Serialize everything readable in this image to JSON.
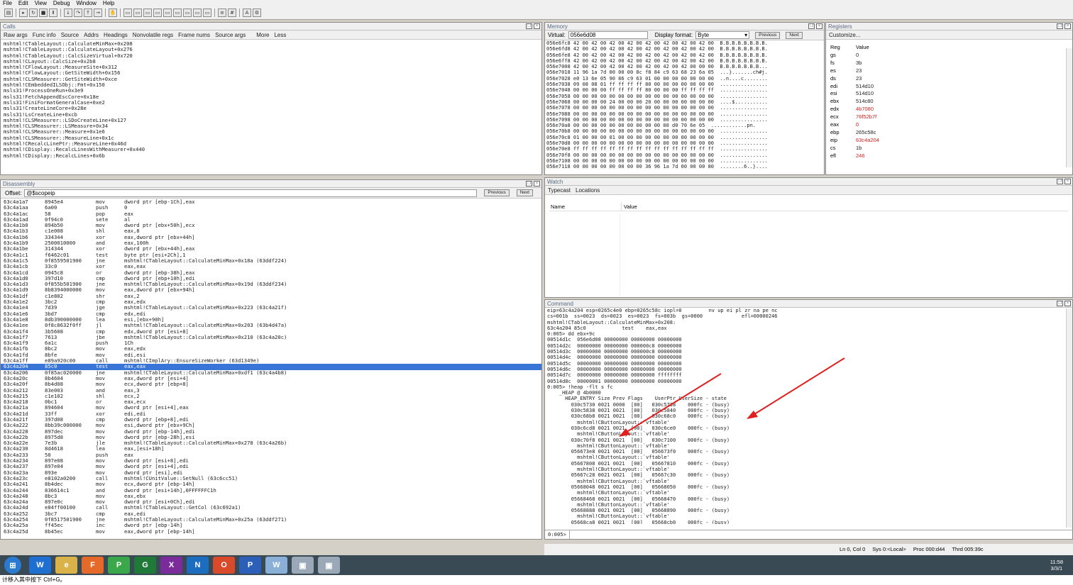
{
  "menu": [
    "File",
    "Edit",
    "View",
    "Debug",
    "Window",
    "Help"
  ],
  "calls": {
    "title": "Calls",
    "tabs": [
      "Raw args",
      "Func info",
      "Source",
      "Addrs",
      "Headings",
      "Nonvolatile regs",
      "Frame nums",
      "Source args",
      "More",
      "Less"
    ],
    "lines": [
      "mshtml!CTableLayout::CalculateMinMax+0x208",
      "mshtml!CTableLayout::CalculateLayout+0x276",
      "mshtml!CTableLayout::CalcSizeVirtual+0x720",
      "mshtml!CLayout::CalcSize+0x2b8",
      "mshtml!CFlowLayout::MeasureSite+0x312",
      "mshtml!CFlowLayout::GetSiteWidth+0x156",
      "mshtml!CLSMeasurer::GetSiteWidth+0xce",
      "mshtml!CEmbeddedILSObj::Fmt+0x150",
      "msls31!ProcessOneRun+0x3e9",
      "msls31!FetchAppendEscCore+0x18e",
      "msls31!FiniFormatGeneralCase+0xe2",
      "msls31!CreateLineCore+0x28e",
      "msls31!LsCreateLine+0xcb",
      "mshtml!CLSMeasurer::LSDoCreateLine+0x127",
      "mshtml!CLSMeasurer::LSMeasure+0x34",
      "mshtml!CLSMeasurer::Measure+0x1e6",
      "mshtml!CLSMeasurer::MeasureLine+0x1c",
      "mshtml!CRecalcLinePtr::MeasureLine+0x46d",
      "mshtml!CDisplay::RecalcLinesWithMeasurer+0x440",
      "mshtml!CDisplay::RecalcLines+0x6b"
    ]
  },
  "memory": {
    "title": "Memory",
    "virtual_label": "Virtual:",
    "virtual_value": "056e6d08",
    "format_label": "Display format:",
    "format_value": "Byte",
    "prev": "Previous",
    "next": "Next",
    "lines": [
      "056e6fc8 42 00 42 00 42 00 42 00 42 00 42 00 42 00 42 00  B.B.B.B.B.B.B.B.",
      "056e6fd8 42 00 42 00 42 00 42 00 42 00 42 00 42 00 42 00  B.B.B.B.B.B.B.B.",
      "056e6fe8 42 00 42 00 42 00 42 00 42 00 42 00 42 00 42 00  B.B.B.B.B.B.B.B.",
      "056e6ff8 42 00 42 00 42 00 42 00 42 00 42 00 42 00 42 00  B.B.B.B.B.B.B.B.",
      "056e7008 42 00 42 00 42 00 42 00 42 00 42 00 42 00 00 00  B.B.B.B.B.B.B...",
      "056e7018 11 96 1a 7d 00 00 00 8c f8 84 c9 63 68 23 6a 05  ...}.......ch#j.",
      "056e7028 e0 13 6e 05 90 86 c9 63 01 00 00 00 00 00 00 00  ..n....c........",
      "056e7038 09 08 08 01 ff ff ff ff 80 00 00 00 00 00 00 00  ................",
      "056e7048 00 00 00 00 ff ff ff ff 80 00 00 00 ff ff ff ff  ................",
      "056e7058 00 00 00 00 00 00 00 00 00 00 00 00 00 00 00 00  ................",
      "056e7068 00 00 00 00 24 00 00 00 20 00 00 00 00 00 00 00  ....$...........",
      "056e7078 00 00 00 00 00 00 00 00 00 00 00 00 00 00 00 00  ................",
      "056e7088 00 00 00 00 00 00 00 00 00 00 00 00 00 00 00 00  ................",
      "056e7098 00 00 00 00 00 00 00 00 00 00 00 00 00 00 00 00  ................",
      "056e70a8 00 00 00 00 00 00 00 00 00 00 00 d0 70 6e 05  ............pn.",
      "056e70b8 00 00 00 00 00 00 00 00 00 00 00 00 00 00 00 00  ................",
      "056e70c8 01 00 00 00 01 00 00 00 00 00 00 00 00 00 00 00  ................",
      "056e70d8 00 00 00 00 00 00 00 00 00 00 00 00 00 00 00 00  ................",
      "056e70e8 ff ff ff ff ff ff ff ff ff ff ff ff ff ff ff ff  ................",
      "056e70f8 00 00 00 00 00 00 00 00 00 00 00 00 00 00 00 00  ................",
      "056e7108 00 00 00 00 00 00 00 00 00 00 00 00 00 00 00 00  ................",
      "056e7118 00 00 00 00 00 00 00 00 36 96 1a 7d 00 00 00 80  ........6..}...."
    ]
  },
  "registers": {
    "title": "Registers",
    "customize": "Customize...",
    "col_reg": "Reg",
    "col_value": "Value",
    "rows": [
      {
        "r": "gs",
        "v": "0",
        "c": "#222"
      },
      {
        "r": "fs",
        "v": "3b",
        "c": "#222"
      },
      {
        "r": "es",
        "v": "23",
        "c": "#222"
      },
      {
        "r": "ds",
        "v": "23",
        "c": "#222"
      },
      {
        "r": "edi",
        "v": "514d10",
        "c": "#222"
      },
      {
        "r": "esi",
        "v": "514d10",
        "c": "#222"
      },
      {
        "r": "ebx",
        "v": "514c80",
        "c": "#222"
      },
      {
        "r": "edx",
        "v": "4b7080",
        "c": "#d02020"
      },
      {
        "r": "ecx",
        "v": "76f52b7f",
        "c": "#d02020"
      },
      {
        "r": "eax",
        "v": "0",
        "c": "#d02020"
      },
      {
        "r": "ebp",
        "v": "265c58c",
        "c": "#222"
      },
      {
        "r": "eip",
        "v": "63c4a204",
        "c": "#d02020"
      },
      {
        "r": "cs",
        "v": "1b",
        "c": "#222"
      },
      {
        "r": "efl",
        "v": "246",
        "c": "#d02020"
      }
    ]
  },
  "disasm": {
    "title": "Disassembly",
    "offset_label": "Offset:",
    "offset_value": "@$scopeip",
    "prev": "Previous",
    "next": "Next",
    "highlight_index": 28,
    "rows": [
      [
        "63c4a1a7",
        "8945e4",
        "mov",
        "dword ptr [ebp-1Ch],eax"
      ],
      [
        "63c4a1aa",
        "6a00",
        "push",
        "0"
      ],
      [
        "63c4a1ac",
        "58",
        "pop",
        "eax"
      ],
      [
        "63c4a1ad",
        "0f94c0",
        "sete",
        "al"
      ],
      [
        "63c4a1b0",
        "894b50",
        "mov",
        "dword ptr [ebx+50h],ecx"
      ],
      [
        "63c4a1b3",
        "c1e008",
        "shl",
        "eax,8"
      ],
      [
        "63c4a1b6",
        "334344",
        "xor",
        "eax,dword ptr [ebx+44h]"
      ],
      [
        "63c4a1b9",
        "2500010000",
        "and",
        "eax,100h"
      ],
      [
        "63c4a1be",
        "314344",
        "xor",
        "dword ptr [ebx+44h],eax"
      ],
      [
        "63c4a1c1",
        "f6462c01",
        "test",
        "byte ptr [esi+2Ch],1"
      ],
      [
        "63c4a1c5",
        "0f8559501900",
        "jne",
        "mshtml!CTableLayout::CalculateMinMax+0x18a (63ddf224)"
      ],
      [
        "63c4a1cb",
        "33c0",
        "xor",
        "eax,eax"
      ],
      [
        "63c4a1cd",
        "0945c8",
        "or",
        "dword ptr [ebp-38h],eax"
      ],
      [
        "63c4a1d0",
        "397d10",
        "cmp",
        "dword ptr [ebp+10h],edi"
      ],
      [
        "63c4a1d3",
        "0f855b501900",
        "jne",
        "mshtml!CTableLayout::CalculateMinMax+0x19d (63ddf234)"
      ],
      [
        "63c4a1d9",
        "8b8394000000",
        "mov",
        "eax,dword ptr [ebx+94h]"
      ],
      [
        "63c4a1df",
        "c1e802",
        "shr",
        "eax,2"
      ],
      [
        "63c4a1e2",
        "3bc2",
        "cmp",
        "eax,edx"
      ],
      [
        "63c4a1e4",
        "7d39",
        "jge",
        "mshtml!CTableLayout::CalculateMinMax+0x223 (63c4a21f)"
      ],
      [
        "63c4a1e6",
        "3bd7",
        "cmp",
        "edx,edi"
      ],
      [
        "63c4a1e8",
        "8db390000000",
        "lea",
        "esi,[ebx+90h]"
      ],
      [
        "63c4a1ee",
        "0f8c8632f0ff",
        "jl",
        "mshtml!CTableLayout::CalculateMinMax+0x203 (63b4d47a)"
      ],
      [
        "63c4a1f4",
        "3b5608",
        "cmp",
        "edx,dword ptr [esi+8]"
      ],
      [
        "63c4a1f7",
        "7613",
        "jbe",
        "mshtml!CTableLayout::CalculateMinMax+0x210 (63c4a20c)"
      ],
      [
        "63c4a1f9",
        "6a1c",
        "push",
        "1Ch"
      ],
      [
        "63c4a1fb",
        "8bc2",
        "mov",
        "eax,edx"
      ],
      [
        "63c4a1fd",
        "8bfe",
        "mov",
        "edi,esi"
      ],
      [
        "63c4a1ff",
        "e89a920c00",
        "call",
        "mshtml!CImplAry::EnsureSizeWorker (63d1349e)"
      ],
      [
        "63c4a204",
        "85c0",
        "test",
        "eax,eax"
      ],
      [
        "63c4a206",
        "0f85ac020000",
        "jne",
        "mshtml!CTableLayout::CalculateMinMax+0xdf1 (63c4a4b8)"
      ],
      [
        "63c4a20c",
        "8b4604",
        "mov",
        "eax,dword ptr [esi+4]"
      ],
      [
        "63c4a20f",
        "8b4d08",
        "mov",
        "ecx,dword ptr [ebp+8]"
      ],
      [
        "63c4a212",
        "83e003",
        "and",
        "eax,3"
      ],
      [
        "63c4a215",
        "c1e102",
        "shl",
        "ecx,2"
      ],
      [
        "63c4a218",
        "0bc1",
        "or",
        "eax,ecx"
      ],
      [
        "63c4a21a",
        "894604",
        "mov",
        "dword ptr [esi+4],eax"
      ],
      [
        "63c4a21d",
        "33ff",
        "xor",
        "edi,edi"
      ],
      [
        "63c4a21f",
        "397d08",
        "cmp",
        "dword ptr [ebp+8],edi"
      ],
      [
        "63c4a222",
        "8bb39c000000",
        "mov",
        "esi,dword ptr [ebx+9Ch]"
      ],
      [
        "63c4a228",
        "897dec",
        "mov",
        "dword ptr [ebp-14h],edi"
      ],
      [
        "63c4a22b",
        "8975d8",
        "mov",
        "dword ptr [ebp-28h],esi"
      ],
      [
        "63c4a22e",
        "7e3b",
        "jle",
        "mshtml!CTableLayout::CalculateMinMax+0x278 (63c4a26b)"
      ],
      [
        "63c4a230",
        "8d4618",
        "lea",
        "eax,[esi+18h]"
      ],
      [
        "63c4a233",
        "50",
        "push",
        "eax"
      ],
      [
        "63c4a234",
        "897e08",
        "mov",
        "dword ptr [esi+8],edi"
      ],
      [
        "63c4a237",
        "897e04",
        "mov",
        "dword ptr [esi+4],edi"
      ],
      [
        "63c4a23a",
        "893e",
        "mov",
        "dword ptr [esi],edi"
      ],
      [
        "63c4a23c",
        "e8102a0200",
        "call",
        "mshtml!CUnitValue::SetNull (63c6cc51)"
      ],
      [
        "63c4a241",
        "8b4dec",
        "mov",
        "ecx,dword ptr [ebp-14h]"
      ],
      [
        "63c4a244",
        "836614c1",
        "and",
        "dword ptr [esi+14h],0FFFFFFC1h"
      ],
      [
        "63c4a248",
        "8bc3",
        "mov",
        "eax,ebx"
      ],
      [
        "63c4a24a",
        "897e0c",
        "mov",
        "dword ptr [esi+0Ch],edi"
      ],
      [
        "63c4a24d",
        "e84ff00100",
        "call",
        "mshtml!CTableLayout::GetCol (63c692a1)"
      ],
      [
        "63c4a252",
        "3bc7",
        "cmp",
        "eax,edi"
      ],
      [
        "63c4a254",
        "0f8517501900",
        "jne",
        "mshtml!CTableLayout::CalculateMinMax+0x25a (63ddf271)"
      ],
      [
        "63c4a25a",
        "ff45ec",
        "inc",
        "dword ptr [ebp-14h]"
      ],
      [
        "63c4a25d",
        "8b45ec",
        "mov",
        "eax,dword ptr [ebp-14h]"
      ]
    ]
  },
  "watch": {
    "title": "Watch",
    "tabs": [
      "Typecast",
      "Locations"
    ],
    "col_name": "Name",
    "col_value": "Value"
  },
  "command": {
    "title": "Command",
    "prompt": "0:005>",
    "lines": [
      "eip=63c4a204 esp=0265c4e0 ebp=0265c58c iopl=0         nv up ei pl zr na pe nc",
      "cs=001b  ss=0023  ds=0023  es=0023  fs=003b  gs=0000             efl=00000246",
      "mshtml!CTableLayout::CalculateMinMax+0x208:",
      "63c4a204 85c0            test    eax,eax",
      "0:005> dd ebx+9c",
      "00514d1c  056e6d08 00000000 00000000 00000000",
      "00514d2c  00000000 00000000 000000c8 00000000",
      "00514d3c  00000000 00000000 000000c8 00000000",
      "00514d4c  00000000 00000000 00000000 00000000",
      "00514d5c  00000000 00000000 00000000 00000000",
      "00514d6c  00000000 00000000 00000000 00000000",
      "00514d7c  00000000 00000000 00000000 ffffffff",
      "00514d8c  00000001 00000000 00000000 00000000",
      "0:005> !heap -flt s fc",
      "    _HEAP @ 4b0000",
      "      HEAP_ENTRY Size Prev Flags    UserPtr UserSize - state",
      "        030c5730 0021 0000  [00]   030c5738    000fc - (busy)",
      "        030c5838 0021 0021  [00]   030c5840    000fc - (busy)",
      "        030c68b8 0021 0021  [00]   030c68c0    000fc - (busy)",
      "          mshtml!CButtonLayout::`vftable'",
      "        030c6cd8 0021 0021  [00]   030c6ce0    000fc - (busy)",
      "          mshtml!CButtonLayout::`vftable'",
      "        030c70f8 0021 0021  [00]   030c7100    000fc - (busy)",
      "          mshtml!CButtonLayout::`vftable'",
      "        056673e8 0021 0021  [00]   056673f0    000fc - (busy)",
      "          mshtml!CButtonLayout::`vftable'",
      "        05667808 0021 0021  [00]   05667810    000fc - (busy)",
      "          mshtml!CButtonLayout::`vftable'",
      "        05667c28 0021 0021  [00]   05667c30    000fc - (busy)",
      "          mshtml!CButtonLayout::`vftable'",
      "        05668048 0021 0021  [00]   05668050    000fc - (busy)",
      "          mshtml!CButtonLayout::`vftable'",
      "        05668468 0021 0021  [00]   05668470    000fc - (busy)",
      "          mshtml!CButtonLayout::`vftable'",
      "        05668888 0021 0021  [00]   05668890    000fc - (busy)",
      "          mshtml!CButtonLayout::`vftable'",
      "        05668ca8 0021 0021  [00]   05668cb0    000fc - (busy)",
      "          mshtml!CButtonLayout::`vftable'"
    ]
  },
  "status": {
    "pos": "Ln 0, Col 0",
    "sys": "Sys 0:<Local>",
    "proc": "Proc 000:d44",
    "thrd": "Thrd 005:39c"
  },
  "taskbar": {
    "apps": [
      "W",
      "e",
      "F",
      "P",
      "G",
      "X",
      "N",
      "O",
      "P",
      "W",
      "▣",
      "▣"
    ],
    "time": "11:58",
    "date": "3/3/1"
  },
  "ime_text": "计移入其中按下 Ctrl+G。",
  "arrow_color": "#e02020"
}
